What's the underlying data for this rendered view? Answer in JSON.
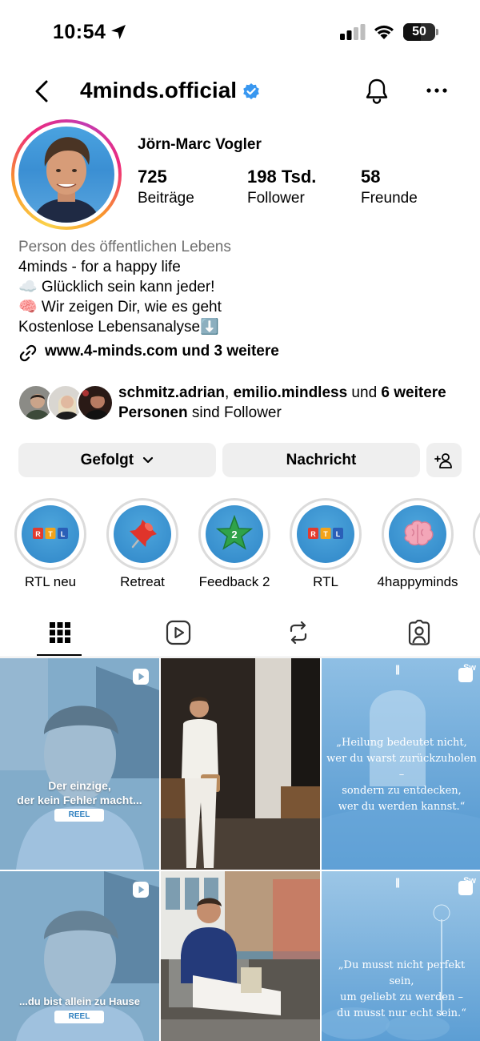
{
  "status_bar": {
    "time": "10:54",
    "battery": "50"
  },
  "header": {
    "username": "4minds.official"
  },
  "profile": {
    "full_name": "Jörn-Marc Vogler",
    "stats": [
      {
        "value": "725",
        "label": "Beiträge"
      },
      {
        "value": "198 Tsd.",
        "label": "Follower"
      },
      {
        "value": "58",
        "label": "Freunde"
      }
    ],
    "category": "Person des öffentlichen Lebens",
    "bio_lines": [
      "4minds - for a happy life",
      "☁️ Glücklich sein kann jeder!",
      "🧠 Wir zeigen Dir, wie es geht",
      "Kostenlose Lebensanalyse⬇️"
    ],
    "link_text": "www.4-minds.com und 3 weitere",
    "followed_by": {
      "user1": "schmitz.adrian",
      "sep": ", ",
      "user2": "emilio.mindless",
      "middle": " und ",
      "others": "6 weitere Personen",
      "end": " sind Follower"
    }
  },
  "buttons": {
    "following": "Gefolgt",
    "message": "Nachricht"
  },
  "highlights": [
    {
      "label": "RTL neu",
      "icon": "rtl-logo-icon"
    },
    {
      "label": "Retreat",
      "icon": "pushpin-icon"
    },
    {
      "label": "Feedback 2",
      "icon": "star-icon"
    },
    {
      "label": "RTL",
      "icon": "rtl-logo-icon"
    },
    {
      "label": "4happyminds",
      "icon": "brain-icon"
    }
  ],
  "rtl_badge": {
    "letters": [
      "R",
      "T",
      "L"
    ]
  },
  "tabs": [
    "grid-icon",
    "reels-icon",
    "reposts-icon",
    "tagged-icon"
  ],
  "posts": {
    "post1": {
      "caption_line1": "Der einzige,",
      "caption_line2": "der kein Fehler macht...",
      "badge": "REEL"
    },
    "post3": {
      "quote_lines": [
        "„Heilung bedeutet nicht,",
        "wer du warst zurückzuholen –",
        "sondern zu entdecken,",
        "wer du werden kannst.“"
      ],
      "tag": "Sw"
    },
    "post4": {
      "caption_line1": "...du bist allein zu Hause",
      "badge": "REEL"
    },
    "post6": {
      "quote_lines": [
        "„Du musst nicht perfekt sein,",
        "um geliebt zu werden –",
        "du musst nur echt sein.“"
      ],
      "tag": "Sw"
    }
  },
  "colors": {
    "accent_blue": "#3897f0",
    "button_bg": "#efefef",
    "highlight_blue": "#2f86c8"
  }
}
